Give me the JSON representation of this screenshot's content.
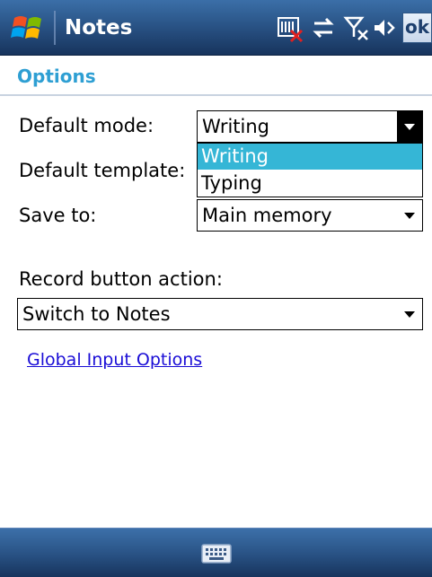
{
  "titlebar": {
    "app_title": "Notes",
    "ok_label": "ok",
    "status_icons": [
      "sim-error-icon",
      "connectivity-icon",
      "no-signal-icon",
      "speaker-icon"
    ]
  },
  "header": {
    "title": "Options"
  },
  "form": {
    "default_mode": {
      "label": "Default mode:",
      "value": "Writing"
    },
    "default_template": {
      "label": "Default template:"
    },
    "save_to": {
      "label": "Save to:",
      "value": "Main memory"
    },
    "record_button_action": {
      "label": "Record button action:",
      "value": "Switch to Notes"
    },
    "mode_dropdown": {
      "options": [
        "Writing",
        "Typing"
      ],
      "selected": "Writing"
    }
  },
  "links": {
    "global_input_options": "Global Input Options"
  },
  "bottombar": {
    "icon": "keyboard-icon"
  },
  "colors": {
    "titlebar": "#2a5487",
    "header_text": "#2e9fd3",
    "selection": "#35b6d6",
    "link": "#1a0dd6"
  }
}
